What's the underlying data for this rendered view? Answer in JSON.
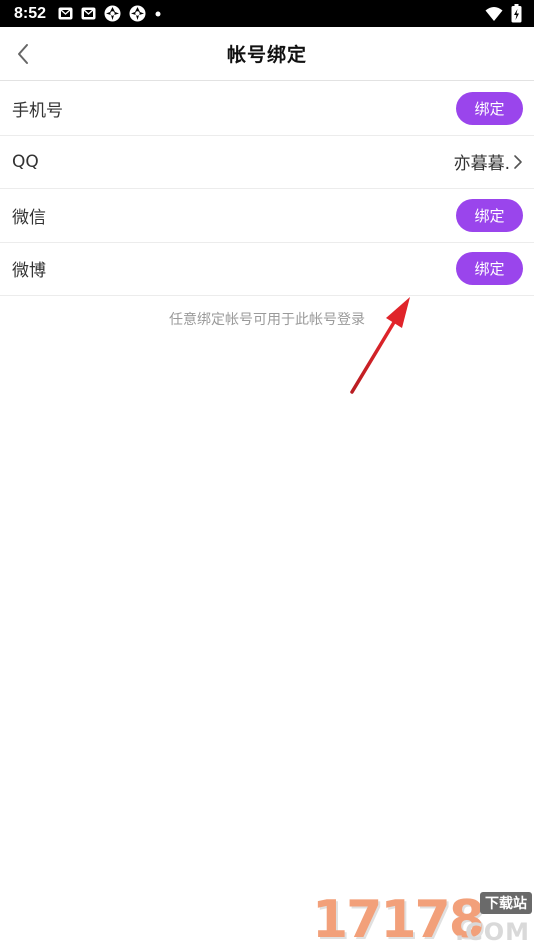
{
  "status_bar": {
    "time": "8:52",
    "left_icons": [
      "mail-icon",
      "mail-icon",
      "aperture-icon",
      "aperture-icon",
      "dot-icon"
    ],
    "right_icons": [
      "wifi-icon",
      "battery-charging-icon"
    ]
  },
  "header": {
    "title": "帐号绑定",
    "back_icon": "chevron-left-icon"
  },
  "accounts": [
    {
      "label": "手机号",
      "bind_label": "绑定"
    },
    {
      "label": "QQ",
      "bound_value": "亦暮暮."
    },
    {
      "label": "微信",
      "bind_label": "绑定"
    },
    {
      "label": "微博",
      "bind_label": "绑定"
    }
  ],
  "hint": "任意绑定帐号可用于此帐号登录",
  "watermark": {
    "digits": "17178",
    "tag": "下载站",
    "suffix": ".COM"
  },
  "colors": {
    "accent": "#9a45ec",
    "arrow": "#d8232a",
    "hint_text": "#9a9a9a"
  }
}
